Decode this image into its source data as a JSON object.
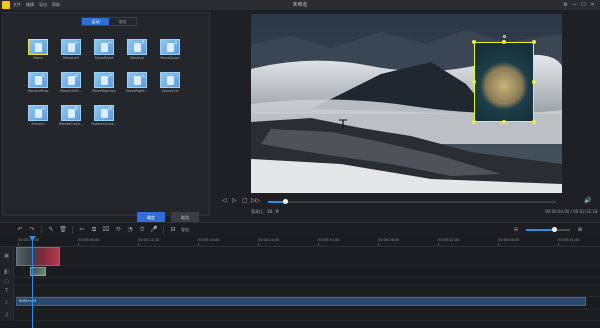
{
  "app": {
    "title": "未命名",
    "menu": [
      "文件",
      "编辑",
      "导出",
      "帮助"
    ],
    "window_controls": [
      "⚙",
      "—",
      "☐",
      "✕"
    ]
  },
  "motion_panel": {
    "tabs": [
      {
        "label": "运动",
        "active": true
      },
      {
        "label": "缩放",
        "active": false
      }
    ],
    "effects": [
      {
        "label": "None",
        "selected": true,
        "arrow": ""
      },
      {
        "label": "MoveLeft",
        "selected": false,
        "arrow": "←"
      },
      {
        "label": "MoveRight",
        "selected": false,
        "arrow": "→"
      },
      {
        "label": "MoveUp",
        "selected": false,
        "arrow": "↑"
      },
      {
        "label": "MoveDown",
        "selected": false,
        "arrow": "↓"
      },
      {
        "label": "MoveLeftUp",
        "selected": false,
        "arrow": "↖"
      },
      {
        "label": "MoveLeftD...",
        "selected": false,
        "arrow": "↙"
      },
      {
        "label": "MoveRightUp",
        "selected": false,
        "arrow": "↗"
      },
      {
        "label": "MoveRight...",
        "selected": false,
        "arrow": "↘"
      },
      {
        "label": "ZoomOut",
        "selected": false,
        "arrow": "-"
      },
      {
        "label": "ZoomIn",
        "selected": false,
        "arrow": "+"
      },
      {
        "label": "RotateClock...",
        "selected": false,
        "arrow": "↻"
      },
      {
        "label": "RotateCount...",
        "selected": false,
        "arrow": "↺"
      }
    ],
    "ok_label": "确定",
    "cancel_label": "取消"
  },
  "player": {
    "controls": [
      "◁",
      "▷",
      "▢",
      "▷▷"
    ],
    "progress": 0.06,
    "aspect_label": "宽高比：",
    "aspect_value": "16 : 9",
    "timecode": "00:00:04.00 / 00:02:31.18"
  },
  "toolbar": {
    "tools": [
      "↶",
      "↷",
      "✎",
      "🗑",
      "✂",
      "⧉",
      "⌧",
      "⟲",
      "◔",
      "⏱",
      "🎤",
      "⊟"
    ],
    "export_label": "导出",
    "zoom_level": 0.64
  },
  "timeline": {
    "ruler": [
      "00:00:00.00",
      "00:00:06.00",
      "00:00:12.00",
      "00:00:18.00",
      "00:00:24.00",
      "00:00:30.00",
      "00:00:36.00",
      "00:00:42.00",
      "00:00:48.00",
      "00:00:54.00"
    ],
    "tracks": [
      "▣",
      "◧",
      "▢",
      "T",
      "♪",
      "♫"
    ],
    "music_clip_label": "BGM.mp3"
  }
}
